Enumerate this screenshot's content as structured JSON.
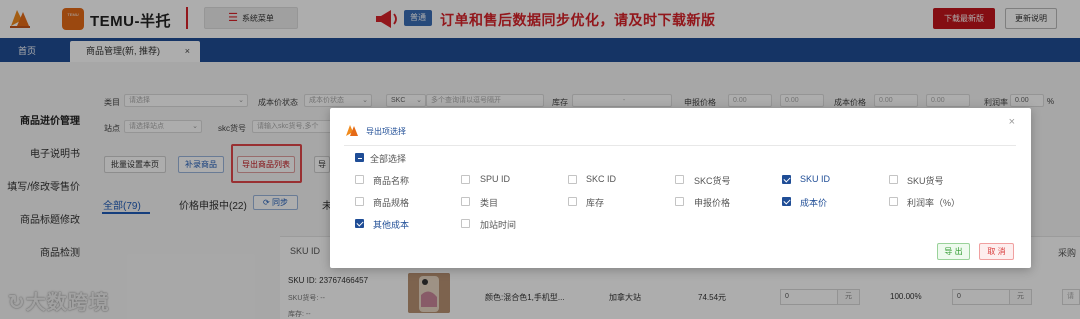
{
  "header": {
    "brand_title": "TEMU-半托",
    "logo_badge_text": "TEMU",
    "system_menu": "系统菜单",
    "notice_tag": "普通",
    "notice_text": "订单和售后数据同步优化，请及时下载新版",
    "download_button": "下载最新版",
    "update_notes_button": "更新说明"
  },
  "tabs": {
    "home": "首页",
    "active": "商品管理(新, 推荐)",
    "close_symbol": "×"
  },
  "sidebar": {
    "items": [
      "商品进价管理",
      "电子说明书",
      "填写/修改零售价",
      "商品标题修改",
      "商品检测"
    ]
  },
  "filters": {
    "category_label": "类目",
    "category_placeholder": "请选择",
    "cost_status_label": "成本价状态",
    "cost_status_placeholder": "成本价状态",
    "skc_label": "SKC",
    "skc_placeholder": "多个查询请以逗号隔开",
    "stock_label": "库存",
    "stock_sep": "-",
    "declared_price_label": "申报价格",
    "declared_from": "0.00",
    "declared_to": "0.00",
    "cost_price_label": "成本价格",
    "cost_from": "0.00",
    "cost_to": "0.00",
    "margin_label": "利润率",
    "margin_from": "0.00",
    "margin_pct": "%",
    "site_label": "站点",
    "site_placeholder": "请选择站点",
    "skc_no_label": "skc货号",
    "skc_no_placeholder": "请输入skc货号,多个"
  },
  "actions": {
    "batch_set": "批量设置本页",
    "add_goods": "补录商品",
    "export_list": "导出商品列表",
    "import_partial": "导"
  },
  "status_tabs": {
    "all": "全部(79)",
    "in_review": "价格申报中(22)",
    "sync": "同步",
    "next_partial": "未"
  },
  "table": {
    "col_sku": "SKU ID",
    "col_purchase": "采购",
    "row": {
      "sku_id": "SKU ID: 23767466457",
      "sku_no": "SKU货号: --",
      "stock": "库存: --",
      "spec": "颜色:混合色1,手机型...",
      "site": "加拿大站",
      "price": "74.54元",
      "cost_value": "0",
      "cost_unit": "元",
      "margin": "100.00%",
      "other_cost_value": "0",
      "other_cost_unit": "元",
      "purchase_placeholder": "请"
    }
  },
  "watermark": "大数跨境",
  "modal": {
    "title": "导出项选择",
    "close": "×",
    "select_all": "全部选择",
    "options": [
      {
        "label": "商品名称",
        "checked": false
      },
      {
        "label": "SPU ID",
        "checked": false
      },
      {
        "label": "SKC ID",
        "checked": false
      },
      {
        "label": "SKC货号",
        "checked": false
      },
      {
        "label": "SKU ID",
        "checked": true
      },
      {
        "label": "SKU货号",
        "checked": false
      },
      {
        "label": "商品规格",
        "checked": false
      },
      {
        "label": "类目",
        "checked": false
      },
      {
        "label": "库存",
        "checked": false
      },
      {
        "label": "申报价格",
        "checked": false
      },
      {
        "label": "成本价",
        "checked": true
      },
      {
        "label": "利润率（%）",
        "checked": false
      },
      {
        "label": "其他成本",
        "checked": true
      },
      {
        "label": "加站时间",
        "checked": false
      }
    ],
    "export_button": "导 出",
    "cancel_button": "取 消"
  },
  "colors": {
    "brand_blue": "#1f4d96",
    "brand_red": "#d8232a",
    "brand_orange": "#e56a17"
  }
}
